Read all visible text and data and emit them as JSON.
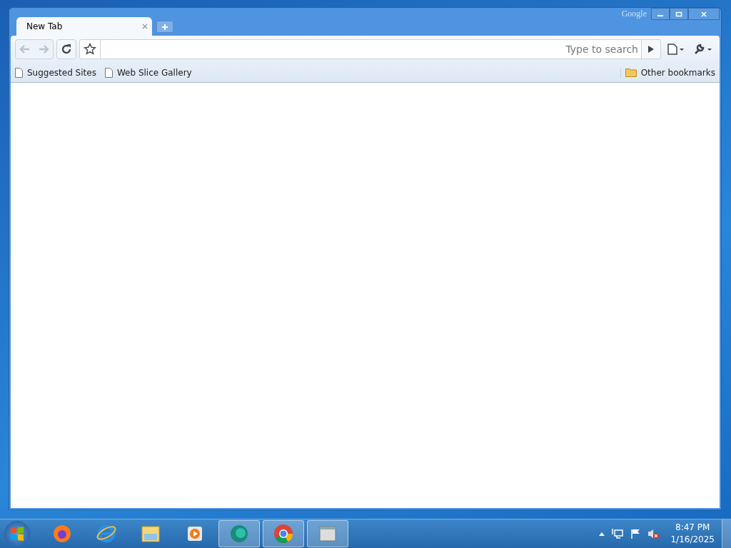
{
  "window": {
    "brand": "Google"
  },
  "tabs": [
    {
      "label": "New Tab",
      "selected": true
    }
  ],
  "nav": [
    {
      "kind": "back",
      "disabled": true
    },
    {
      "kind": "forward",
      "disabled": true
    }
  ],
  "omnibox": {
    "placeholder": "Type to search"
  },
  "bookmarks": [
    {
      "label": "Suggested Sites"
    },
    {
      "label": "Web Slice Gallery"
    }
  ],
  "other_bookmarks": "Other bookmarks",
  "taskbar": {
    "apps": [
      {
        "kind": "firefox",
        "running": false
      },
      {
        "kind": "ie",
        "running": false
      },
      {
        "kind": "explorer",
        "running": false
      },
      {
        "kind": "media",
        "running": false
      },
      {
        "kind": "teal",
        "running": true
      },
      {
        "kind": "chrome",
        "running": true
      },
      {
        "kind": "window",
        "running": true
      }
    ],
    "clock": {
      "time": "8:47 PM",
      "date": "1/16/2025"
    }
  }
}
